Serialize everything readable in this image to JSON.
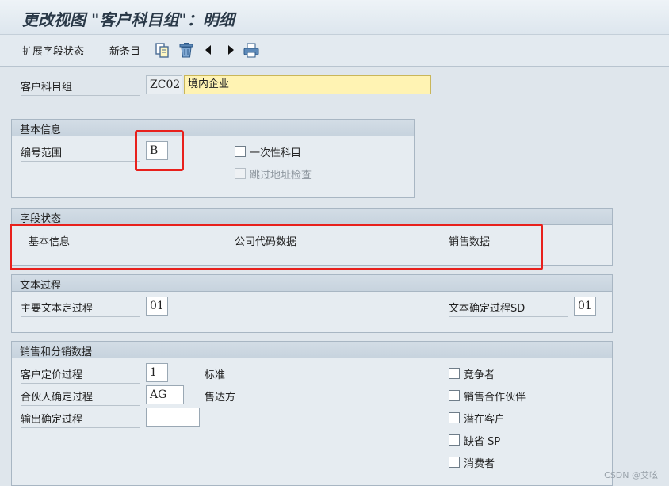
{
  "window": {
    "title": "更改视图 \"客户科目组\"：明细"
  },
  "toolbar": {
    "expand_field_status": "扩展字段状态",
    "new_entries": "新条目",
    "icons": [
      "copy-icon",
      "delete-icon",
      "previous-icon",
      "next-icon",
      "print-icon"
    ]
  },
  "account_group": {
    "label": "客户科目组",
    "code": "ZC02",
    "description": "境内企业"
  },
  "basic_info": {
    "heading": "基本信息",
    "number_range_label": "编号范围",
    "number_range_value": "B",
    "one_time_label": "一次性科目",
    "skip_address_check_label": "跳过地址检查"
  },
  "field_status": {
    "heading": "字段状态",
    "col_basic": "基本信息",
    "col_company_code": "公司代码数据",
    "col_sales": "销售数据"
  },
  "text_procedure": {
    "heading": "文本过程",
    "main_label": "主要文本定过程",
    "main_value": "01",
    "sd_label": "文本确定过程SD",
    "sd_value": "01"
  },
  "sales": {
    "heading": "销售和分销数据",
    "pricing_label": "客户定价过程",
    "pricing_value": "1",
    "pricing_desc": "标准",
    "partner_label": "合伙人确定过程",
    "partner_value": "AG",
    "partner_desc": "售达方",
    "output_label": "输出确定过程",
    "output_value": "",
    "checkboxes": [
      "竞争者",
      "销售合作伙伴",
      "潜在客户",
      "缺省 SP",
      "消费者"
    ]
  },
  "watermark": "CSDN @艾吆",
  "colors": {
    "highlight": "#e8201c",
    "required_field": "#fff3b3"
  }
}
